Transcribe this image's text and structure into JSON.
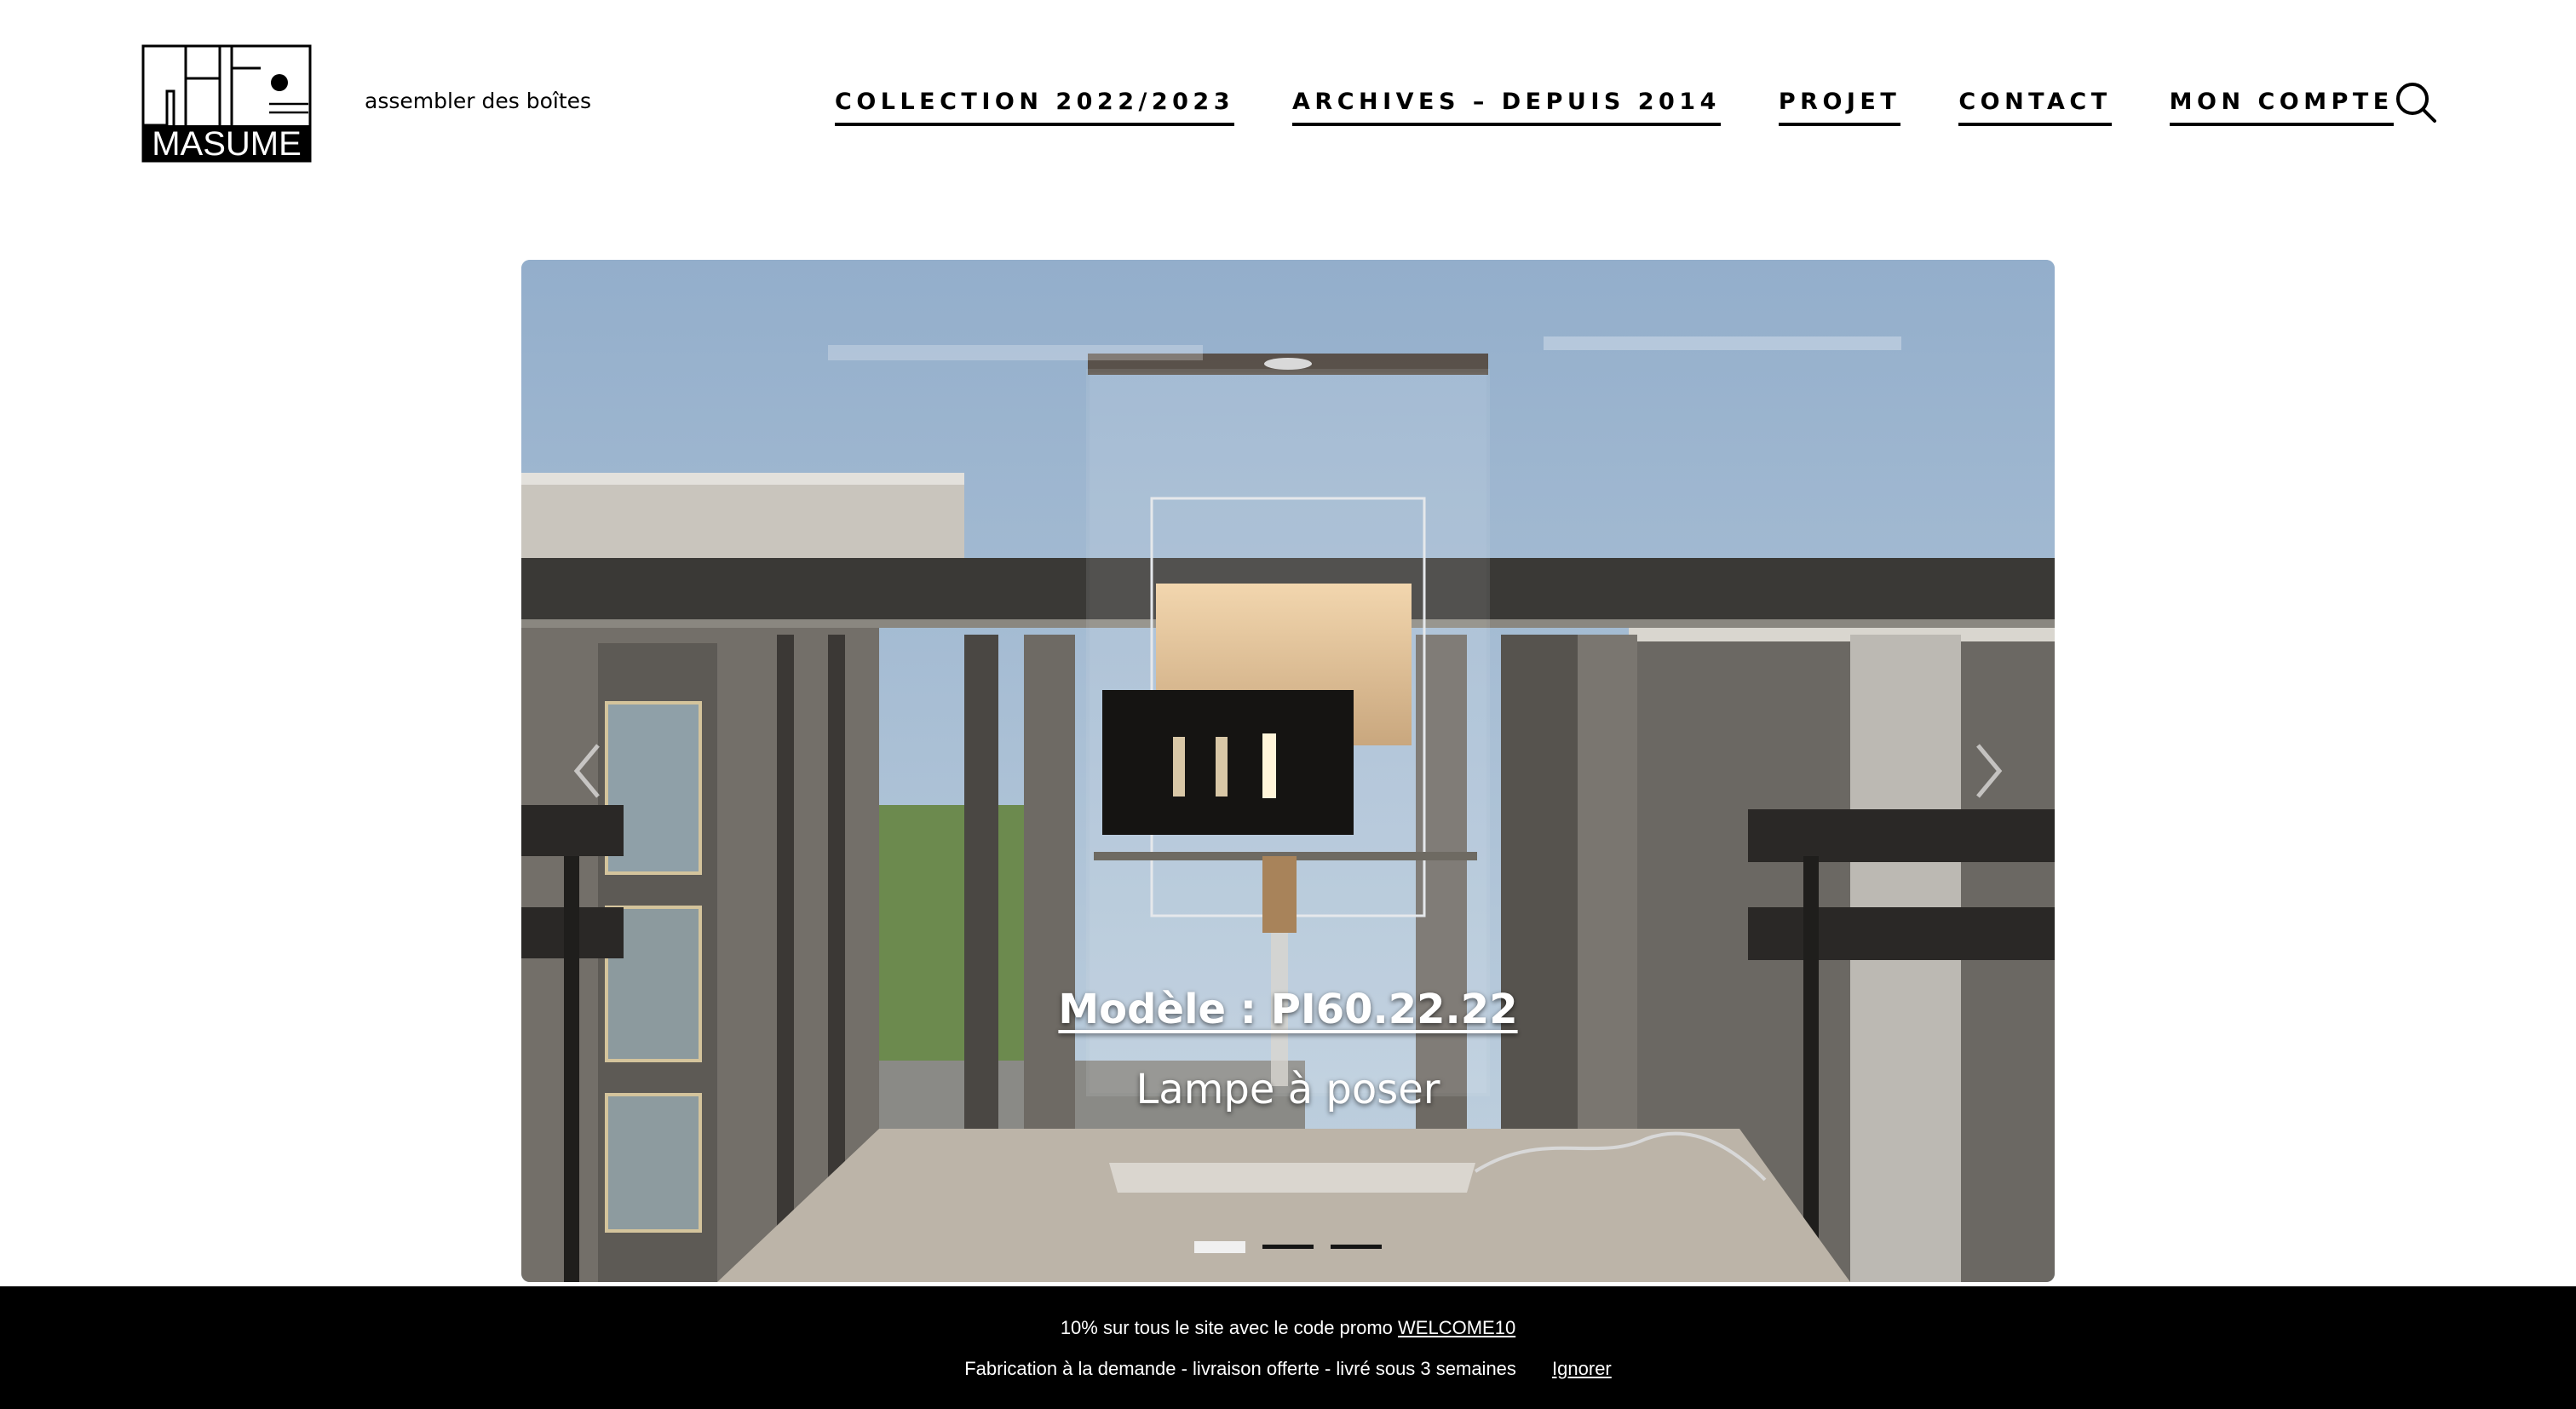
{
  "header": {
    "logo_text": "MASUME",
    "tagline": "assembler des boîtes",
    "nav": [
      {
        "label": "COLLECTION 2022/2023"
      },
      {
        "label": "ARCHIVES – DEPUIS 2014"
      },
      {
        "label": "PROJET"
      },
      {
        "label": "CONTACT"
      },
      {
        "label": "MON COMPTE"
      }
    ],
    "search_icon": "search-icon"
  },
  "slider": {
    "title": "Modèle : PI60.22.22",
    "subtitle": "Lampe à poser",
    "slide_count": 3,
    "active_slide": 1,
    "prev_icon": "chevron-left-icon",
    "next_icon": "chevron-right-icon"
  },
  "promo": {
    "line1_text": "10% sur tous le site avec le code promo",
    "code": "WELCOME10",
    "line2_text": "Fabrication à la demande - livraison offerte - livré sous 3 semaines",
    "dismiss_label": "Ignorer"
  },
  "colors": {
    "background": "#ffffff",
    "text": "#000000",
    "promo_background": "#000000",
    "promo_text": "#ffffff",
    "caption_text": "#ffffff"
  }
}
